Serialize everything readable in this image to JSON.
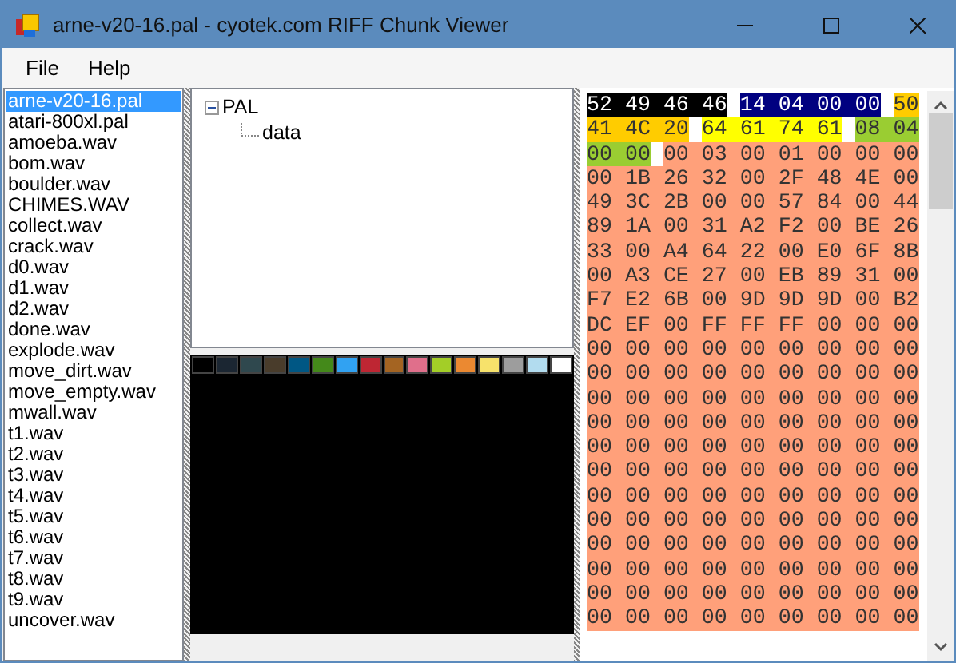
{
  "window": {
    "title": "arne-v20-16.pal - cyotek.com RIFF Chunk Viewer"
  },
  "menu": [
    {
      "label": "File"
    },
    {
      "label": "Help"
    }
  ],
  "files": [
    {
      "label": "arne-v20-16.pal",
      "selected": true
    },
    {
      "label": "atari-800xl.pal",
      "selected": false
    },
    {
      "label": "amoeba.wav",
      "selected": false
    },
    {
      "label": "bom.wav",
      "selected": false
    },
    {
      "label": "boulder.wav",
      "selected": false
    },
    {
      "label": "CHIMES.WAV",
      "selected": false
    },
    {
      "label": "collect.wav",
      "selected": false
    },
    {
      "label": "crack.wav",
      "selected": false
    },
    {
      "label": "d0.wav",
      "selected": false
    },
    {
      "label": "d1.wav",
      "selected": false
    },
    {
      "label": "d2.wav",
      "selected": false
    },
    {
      "label": "done.wav",
      "selected": false
    },
    {
      "label": "explode.wav",
      "selected": false
    },
    {
      "label": "move_dirt.wav",
      "selected": false
    },
    {
      "label": "move_empty.wav",
      "selected": false
    },
    {
      "label": "mwall.wav",
      "selected": false
    },
    {
      "label": "t1.wav",
      "selected": false
    },
    {
      "label": "t2.wav",
      "selected": false
    },
    {
      "label": "t3.wav",
      "selected": false
    },
    {
      "label": "t4.wav",
      "selected": false
    },
    {
      "label": "t5.wav",
      "selected": false
    },
    {
      "label": "t6.wav",
      "selected": false
    },
    {
      "label": "t7.wav",
      "selected": false
    },
    {
      "label": "t8.wav",
      "selected": false
    },
    {
      "label": "t9.wav",
      "selected": false
    },
    {
      "label": "uncover.wav",
      "selected": false
    }
  ],
  "tree": [
    {
      "label": "PAL",
      "expanded": true,
      "children": [
        {
          "label": "data"
        }
      ]
    }
  ],
  "palette": [
    {
      "color": "#000000"
    },
    {
      "color": "#1b2632"
    },
    {
      "color": "#2f484e"
    },
    {
      "color": "#493c2b"
    },
    {
      "color": "#005784"
    },
    {
      "color": "#44891a"
    },
    {
      "color": "#31a2f2"
    },
    {
      "color": "#be2633"
    },
    {
      "color": "#a46422"
    },
    {
      "color": "#e06f8b"
    },
    {
      "color": "#a3ce27"
    },
    {
      "color": "#eb8931"
    },
    {
      "color": "#f7e26b"
    },
    {
      "color": "#9d9d9d"
    },
    {
      "color": "#b2dcef"
    },
    {
      "color": "#ffffff"
    }
  ],
  "hex": {
    "segments": [
      {
        "color": "#000000",
        "bytes": [
          "52",
          "49",
          "46",
          "46"
        ]
      },
      {
        "color": "#000080",
        "bytes": [
          "14",
          "04",
          "00",
          "00"
        ]
      },
      {
        "color": "#ffcc00",
        "bytes": [
          "50",
          "41",
          "4C",
          "20"
        ]
      },
      {
        "color": "#ffff00",
        "bytes": [
          "64",
          "61",
          "74",
          "61"
        ]
      },
      {
        "color": "#9acd32",
        "bytes": [
          "08",
          "04",
          "00",
          "00"
        ]
      },
      {
        "color": "#ffa07a",
        "bytes": [
          "00",
          "03",
          "00",
          "01",
          "00",
          "00",
          "00",
          "00",
          "1B",
          "26",
          "32",
          "00",
          "2F",
          "48",
          "4E",
          "00",
          "49",
          "3C",
          "2B",
          "00",
          "00",
          "57",
          "84",
          "00",
          "44",
          "89",
          "1A",
          "00",
          "31",
          "A2",
          "F2",
          "00",
          "BE",
          "26",
          "33",
          "00",
          "A4",
          "64",
          "22",
          "00",
          "E0",
          "6F",
          "8B",
          "00",
          "A3",
          "CE",
          "27",
          "00",
          "EB",
          "89",
          "31",
          "00",
          "F7",
          "E2",
          "6B",
          "00",
          "9D",
          "9D",
          "9D",
          "00",
          "B2",
          "DC",
          "EF",
          "00",
          "FF",
          "FF",
          "FF",
          "00",
          "00",
          "00",
          "00",
          "00",
          "00",
          "00",
          "00",
          "00",
          "00",
          "00",
          "00",
          "00",
          "00",
          "00",
          "00",
          "00",
          "00",
          "00",
          "00",
          "00",
          "00",
          "00",
          "00",
          "00",
          "00",
          "00",
          "00",
          "00",
          "00",
          "00",
          "00",
          "00",
          "00",
          "00",
          "00",
          "00",
          "00",
          "00",
          "00",
          "00",
          "00",
          "00",
          "00",
          "00",
          "00",
          "00",
          "00",
          "00",
          "00",
          "00",
          "00",
          "00",
          "00",
          "00",
          "00",
          "00",
          "00",
          "00",
          "00",
          "00",
          "00",
          "00",
          "00",
          "00",
          "00",
          "00",
          "00",
          "00",
          "00",
          "00",
          "00",
          "00",
          "00",
          "00",
          "00",
          "00",
          "00",
          "00",
          "00",
          "00",
          "00",
          "00",
          "00",
          "00",
          "00",
          "00",
          "00",
          "00",
          "00",
          "00",
          "00",
          "00",
          "00",
          "00",
          "00",
          "00",
          "00",
          "00",
          "00",
          "00",
          "00",
          "00",
          "00",
          "00",
          "00",
          "00",
          "00",
          "00",
          "00",
          "00"
        ]
      }
    ]
  }
}
